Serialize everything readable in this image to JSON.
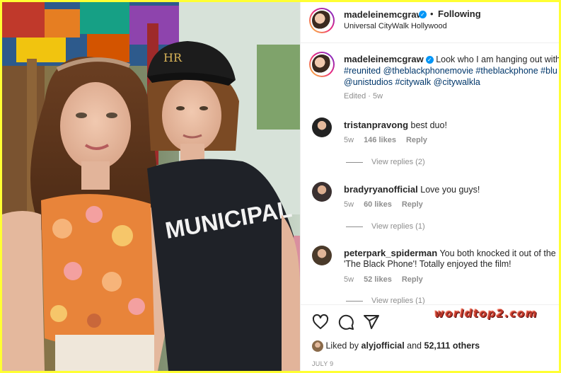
{
  "post": {
    "author": "madeleinemcgraw",
    "follow_label": "Following",
    "location": "Universal CityWalk Hollywood",
    "caption": {
      "line1_text": "Look who I am hanging out with",
      "line2": "#reunited @theblackphonemovie #theblackphone #blu",
      "line3": "@unistudios #citywalk @citywalkla",
      "meta": "Edited · 5w"
    }
  },
  "comments": [
    {
      "user": "tristanpravong",
      "text": "best duo!",
      "age": "5w",
      "likes": "146 likes",
      "reply": "Reply",
      "view_replies": "View replies (2)"
    },
    {
      "user": "bradyryanofficial",
      "text": "Love you guys!",
      "age": "5w",
      "likes": "60 likes",
      "reply": "Reply",
      "view_replies": "View replies (1)"
    },
    {
      "user": "peterpark_spiderman",
      "text": "You both knocked it out of the p",
      "text2": "'The Black Phone'! Totally enjoyed the film!",
      "age": "5w",
      "likes": "52 likes",
      "reply": "Reply",
      "view_replies": "View replies (1)"
    }
  ],
  "actions": {
    "liked_by_prefix": "Liked by",
    "liked_by_user": "alyjofficial",
    "liked_by_and": "and",
    "liked_by_count": "52,111 others",
    "date": "JULY 9"
  },
  "photo": {
    "cap_text": "HR",
    "shirt_text": "MUNICIPAL"
  },
  "watermark": "worldtop2.com",
  "icons": [
    "heart-icon",
    "comment-icon",
    "share-icon",
    "verified-badge-icon"
  ],
  "colors": {
    "border": "#ffff33",
    "link": "#00376b",
    "verified": "#0095f6",
    "watermark": "#c0392b"
  }
}
